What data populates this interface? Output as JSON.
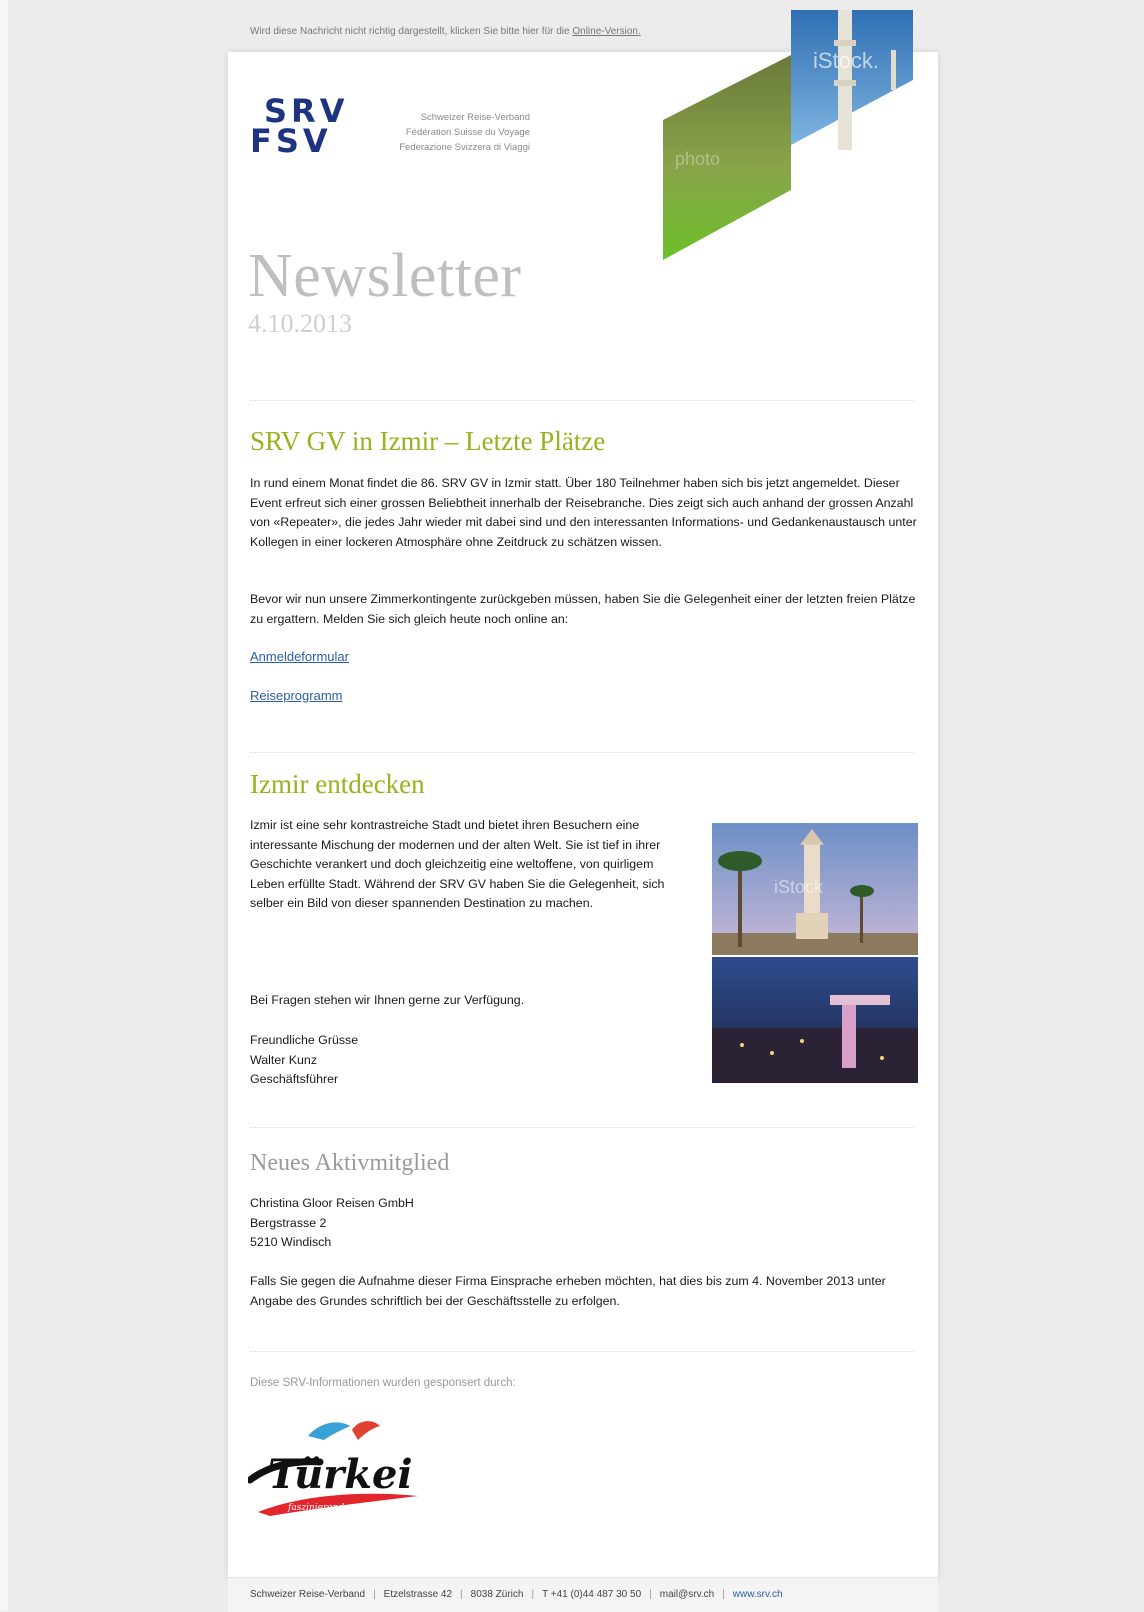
{
  "preheader": {
    "text": "Wird diese Nachricht nicht richtig dargestellt, klicken Sie bitte hier für die ",
    "link": "Online-Version."
  },
  "logo": {
    "srv": "SRV",
    "fsv": "FSV",
    "lines": [
      "Schweizer Reise-Verband",
      "Fédération Suisse du Voyage",
      "Federazione Svizzera di Viaggi"
    ]
  },
  "header_image": {
    "watermark_top": "iStock.",
    "watermark_mid": "photo"
  },
  "newsletter": {
    "title": "Newsletter",
    "date": "4.10.2013"
  },
  "article1": {
    "heading": "SRV GV in Izmir – Letzte Plätze",
    "p1": "In rund einem Monat findet die 86. SRV GV in Izmir statt. Über 180 Teilnehmer haben sich bis jetzt angemeldet. Dieser Event erfreut sich einer grossen Beliebtheit innerhalb der Reisebranche. Dies zeigt sich auch anhand der grossen Anzahl von «Repeater», die jedes Jahr wieder mit dabei sind und den interessanten Informations- und Gedankenaustausch unter Kollegen in einer lockeren Atmosphäre ohne Zeitdruck zu schätzen wissen.",
    "p2": "Bevor wir nun unsere Zimmerkontingente zurückgeben müssen, haben Sie die Gelegenheit einer der letzten freien Plätze zu ergattern. Melden Sie sich gleich heute noch online an:",
    "link1": "Anmeldeformular",
    "link2": "Reiseprogramm"
  },
  "article2": {
    "heading": "Izmir entdecken",
    "p1": "Izmir ist eine sehr kontrastreiche Stadt und bietet ihren Besuchern eine interessante Mischung der modernen und der alten Welt. Sie ist tief in ihrer Geschichte verankert und doch gleichzeitig eine weltoffene, von quirligem Leben erfüllte Stadt. Während der SRV GV haben Sie die Gelegenheit, sich selber ein Bild von dieser spannenden Destination zu machen.",
    "p2": "Bei Fragen stehen wir Ihnen gerne zur Verfügung.",
    "sign1": "Freundliche Grüsse",
    "sign2": "Walter Kunz",
    "sign3": "Geschäftsführer",
    "img_watermark": "iStock"
  },
  "article3": {
    "heading": "Neues Aktivmitglied",
    "addr1": "Christina Gloor Reisen GmbH",
    "addr2": "Bergstrasse 2",
    "addr3": "5210 Windisch",
    "p1": "Falls Sie gegen die Aufnahme dieser Firma Einsprache erheben möchten, hat dies bis zum 4. November 2013 unter Angabe des Grundes schriftlich bei der Geschäftsstelle zu erfolgen."
  },
  "sponsor": {
    "label": "Diese SRV-Informationen wurden gesponsert durch:",
    "logo_text": "Türkei",
    "logo_sub": "faszinierend"
  },
  "footer": {
    "org": "Schweizer Reise-Verband",
    "street": "Etzelstrasse 42",
    "city": "8038 Zürich",
    "phone": "T +41 (0)44 487 30 50",
    "email": "mail@srv.ch",
    "web": "www.srv.ch"
  },
  "colors": {
    "accent_green": "#9ab11e",
    "brand_blue": "#1e3480",
    "link_blue": "#2b5da8"
  }
}
